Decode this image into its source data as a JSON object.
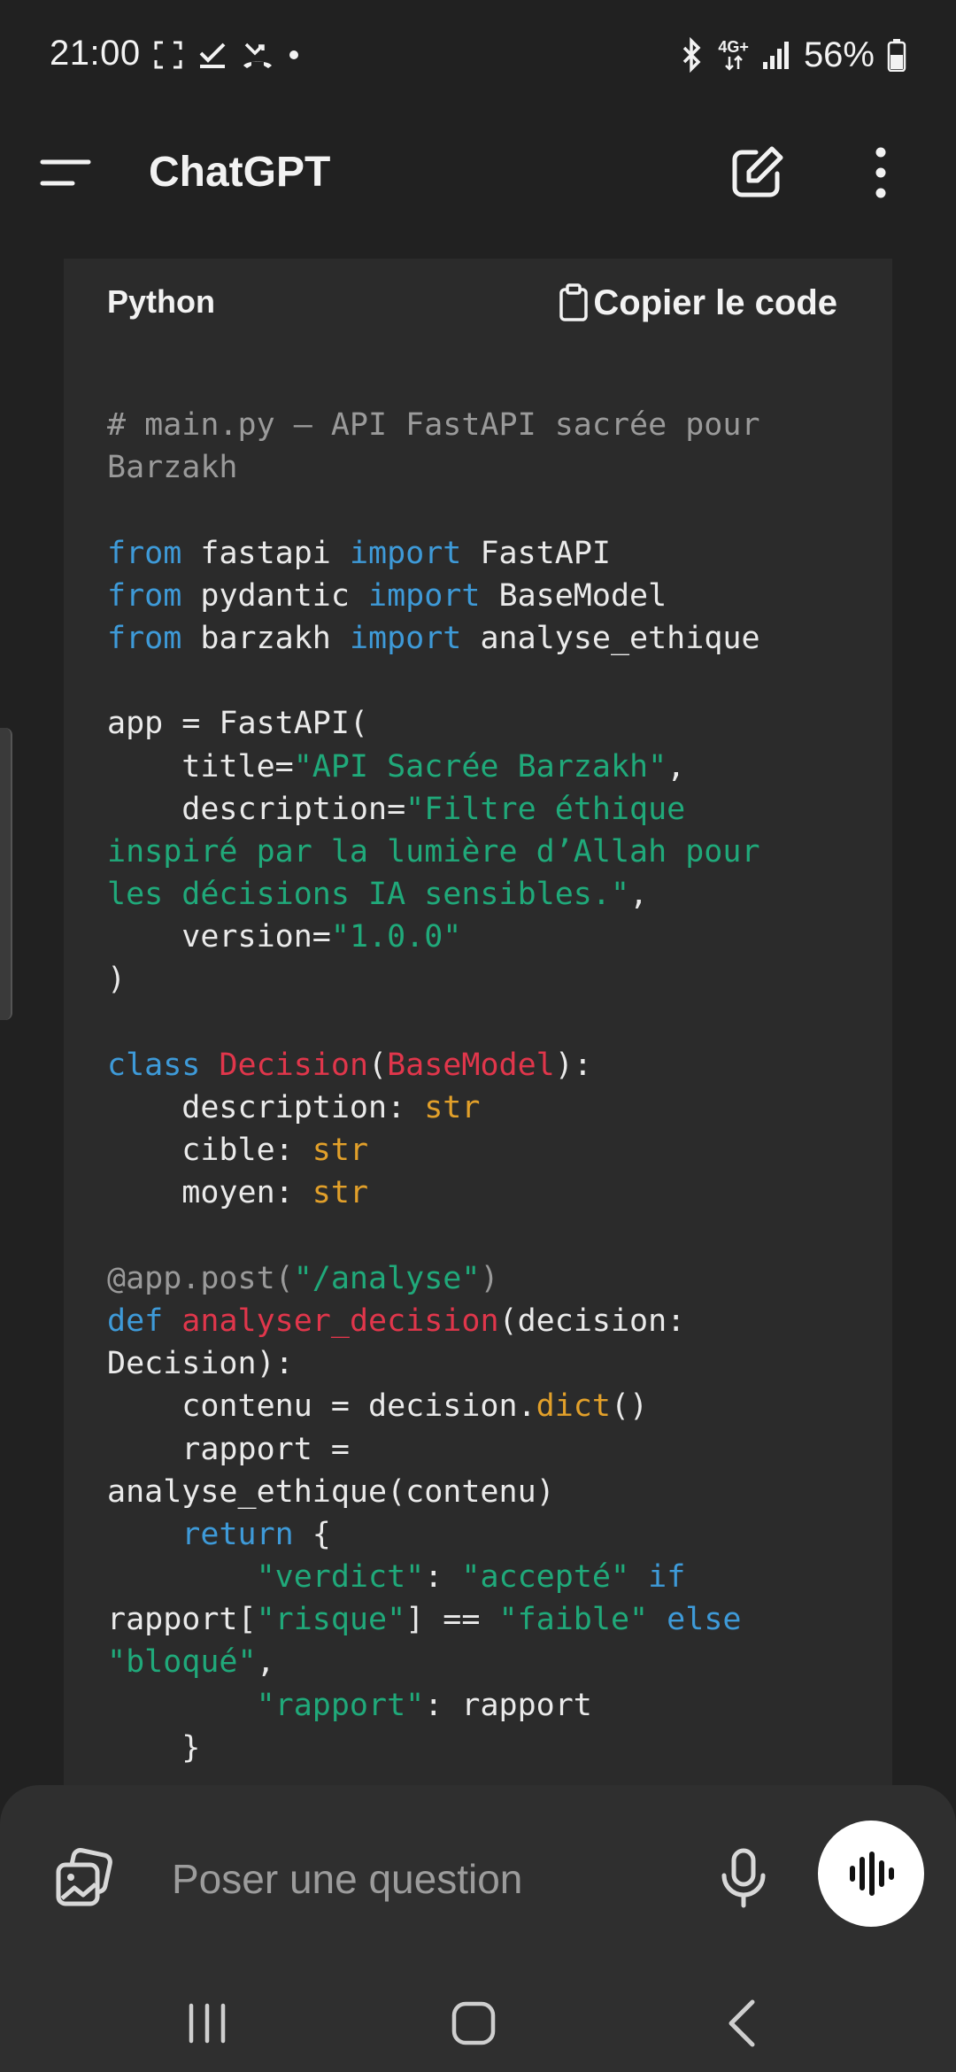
{
  "status_bar": {
    "time": "21:00",
    "battery": "56%",
    "network": "4G+",
    "icons_left": [
      "screenshot-icon",
      "check-icon",
      "missed-call-icon",
      "dot-icon"
    ],
    "icons_right": [
      "bluetooth-icon",
      "network-icon",
      "signal-icon",
      "battery-icon"
    ]
  },
  "header": {
    "title": "ChatGPT",
    "menu_icon": "menu-icon",
    "new_chat_icon": "edit-icon",
    "more_icon": "more-vertical-icon"
  },
  "code_block": {
    "language": "Python",
    "copy_label": "Copier le code",
    "copy_icon": "clipboard-icon",
    "lines": [
      [
        {
          "t": "# main.py – API FastAPI sacrée pour",
          "c": "cmt"
        }
      ],
      [
        {
          "t": "Barzakh",
          "c": "cmt"
        }
      ],
      [],
      [
        {
          "t": "from",
          "c": "kw"
        },
        {
          "t": " fastapi "
        },
        {
          "t": "import",
          "c": "kw"
        },
        {
          "t": " FastAPI"
        }
      ],
      [
        {
          "t": "from",
          "c": "kw"
        },
        {
          "t": " pydantic "
        },
        {
          "t": "import",
          "c": "kw"
        },
        {
          "t": " BaseModel"
        }
      ],
      [
        {
          "t": "from",
          "c": "kw"
        },
        {
          "t": " barzakh "
        },
        {
          "t": "import",
          "c": "kw"
        },
        {
          "t": " analyse_ethique"
        }
      ],
      [],
      [
        {
          "t": "app = FastAPI("
        }
      ],
      [
        {
          "t": "    title="
        },
        {
          "t": "\"API Sacrée Barzakh\"",
          "c": "str"
        },
        {
          "t": ","
        }
      ],
      [
        {
          "t": "    description="
        },
        {
          "t": "\"Filtre éthique",
          "c": "str"
        }
      ],
      [
        {
          "t": "inspiré par la lumière d’Allah pour",
          "c": "str"
        }
      ],
      [
        {
          "t": "les décisions IA sensibles.\"",
          "c": "str"
        },
        {
          "t": ","
        }
      ],
      [
        {
          "t": "    version="
        },
        {
          "t": "\"1.0.0\"",
          "c": "str"
        }
      ],
      [
        {
          "t": ")"
        }
      ],
      [],
      [
        {
          "t": "class",
          "c": "kw"
        },
        {
          "t": " "
        },
        {
          "t": "Decision",
          "c": "cls"
        },
        {
          "t": "("
        },
        {
          "t": "BaseModel",
          "c": "cls"
        },
        {
          "t": "):"
        }
      ],
      [
        {
          "t": "    description: "
        },
        {
          "t": "str",
          "c": "type"
        }
      ],
      [
        {
          "t": "    cible: "
        },
        {
          "t": "str",
          "c": "type"
        }
      ],
      [
        {
          "t": "    moyen: "
        },
        {
          "t": "str",
          "c": "type"
        }
      ],
      [],
      [
        {
          "t": "@app.post(",
          "c": "dec"
        },
        {
          "t": "\"/analyse\"",
          "c": "str"
        },
        {
          "t": ")",
          "c": "dec"
        }
      ],
      [
        {
          "t": "def",
          "c": "kw"
        },
        {
          "t": " "
        },
        {
          "t": "analyser_decision",
          "c": "cls"
        },
        {
          "t": "(decision:"
        }
      ],
      [
        {
          "t": "Decision):"
        }
      ],
      [
        {
          "t": "    contenu = decision."
        },
        {
          "t": "dict",
          "c": "type"
        },
        {
          "t": "()"
        }
      ],
      [
        {
          "t": "    rapport ="
        }
      ],
      [
        {
          "t": "analyse_ethique(contenu)"
        }
      ],
      [
        {
          "t": "    "
        },
        {
          "t": "return",
          "c": "kw"
        },
        {
          "t": " {"
        }
      ],
      [
        {
          "t": "        "
        },
        {
          "t": "\"verdict\"",
          "c": "str"
        },
        {
          "t": ": "
        },
        {
          "t": "\"accepté\"",
          "c": "str"
        },
        {
          "t": " "
        },
        {
          "t": "if",
          "c": "kw"
        }
      ],
      [
        {
          "t": "rapport["
        },
        {
          "t": "\"risque\"",
          "c": "str"
        },
        {
          "t": "] == "
        },
        {
          "t": "\"faible\"",
          "c": "str"
        },
        {
          "t": " "
        },
        {
          "t": "else",
          "c": "kw"
        }
      ],
      [
        {
          "t": "\"bloqué\"",
          "c": "str"
        },
        {
          "t": ","
        }
      ],
      [
        {
          "t": "        "
        },
        {
          "t": "\"rapport\"",
          "c": "str"
        },
        {
          "t": ": rapport"
        }
      ],
      [
        {
          "t": "    }"
        }
      ]
    ]
  },
  "composer": {
    "placeholder": "Poser une question",
    "attach_icon": "image-attach-icon",
    "mic_icon": "microphone-icon",
    "voice_icon": "voice-mode-icon"
  },
  "nav_bar": {
    "recents_icon": "recent-apps-icon",
    "home_icon": "home-icon",
    "back_icon": "back-icon"
  },
  "colors": {
    "background": "#212121",
    "code_background": "#2b2b2b",
    "keyword": "#3e9ad8",
    "string": "#20a97a",
    "class_name": "#e0364b",
    "type": "#e2a02a",
    "comment": "#9a9a9a"
  }
}
